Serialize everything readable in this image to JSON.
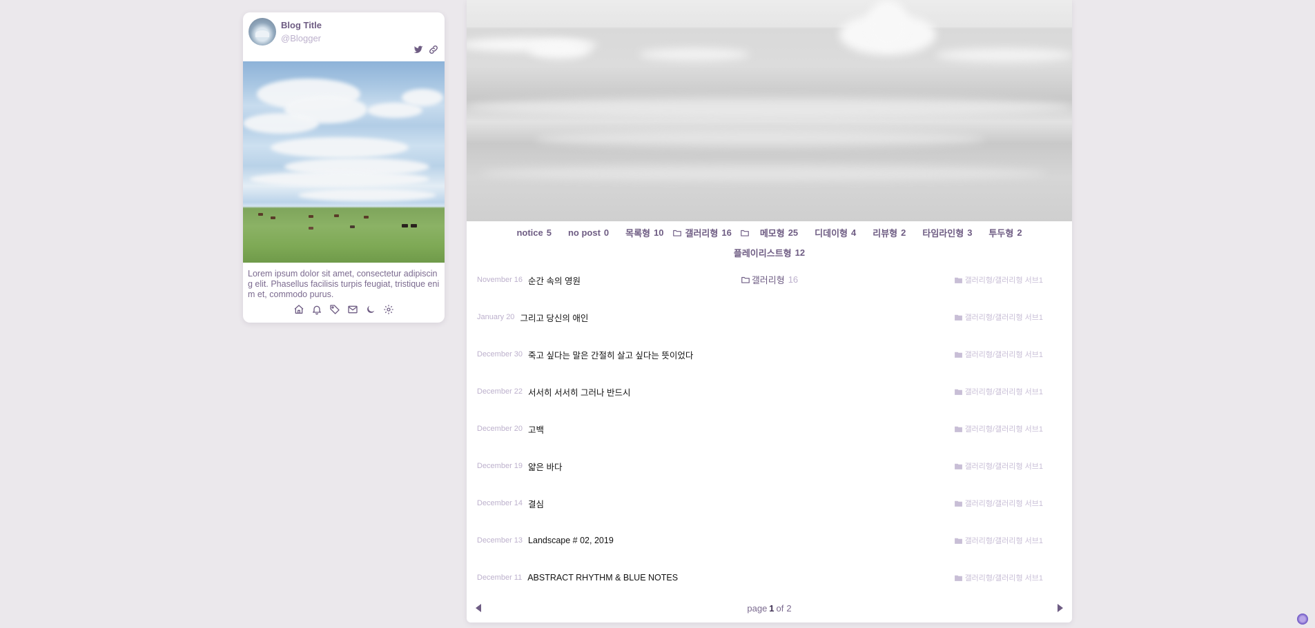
{
  "profile": {
    "title": "Blog Title",
    "username": "@Blogger",
    "description": "Lorem ipsum dolor sit amet, consectetur adipiscing elit. Phasellus facilisis turpis feugiat, tristique enim et, commodo purus.",
    "social_icons": [
      "twitter-icon",
      "link-icon"
    ],
    "bottom_icons": [
      "home-icon",
      "bell-icon",
      "tag-icon",
      "mail-icon",
      "moon-icon",
      "gear-icon"
    ]
  },
  "nav": {
    "items": [
      {
        "label": "notice",
        "count": "5",
        "folder": false
      },
      {
        "label": "no post",
        "count": "0",
        "folder": false
      },
      {
        "label": "목록형",
        "count": "10",
        "folder": false
      },
      {
        "label": "갤러리형",
        "count": "16",
        "folder": true
      },
      {
        "label": "메모형",
        "count": "25",
        "folder": true
      },
      {
        "label": "디데이형",
        "count": "4",
        "folder": false
      },
      {
        "label": "리뷰형",
        "count": "2",
        "folder": false
      },
      {
        "label": "타임라인형",
        "count": "3",
        "folder": false
      },
      {
        "label": "투두형",
        "count": "2",
        "folder": false
      },
      {
        "label": "플레이리스트형",
        "count": "12",
        "folder": false
      }
    ],
    "current": {
      "label": "갤러리형",
      "count": "16"
    }
  },
  "posts": [
    {
      "date": "November 16",
      "title": "순간 속의 영원",
      "category": "갤러리형/갤러리형 서브1"
    },
    {
      "date": "January 20",
      "title": "그리고 당신의 애인",
      "category": "갤러리형/갤러리형 서브1"
    },
    {
      "date": "December 30",
      "title": "죽고 싶다는 말은 간절히 살고 싶다는 뜻이었다",
      "category": "갤러리형/갤러리형 서브1"
    },
    {
      "date": "December 22",
      "title": "서서히 서서히 그러나 반드시",
      "category": "갤러리형/갤러리형 서브1"
    },
    {
      "date": "December 20",
      "title": "고백",
      "category": "갤러리형/갤러리형 서브1"
    },
    {
      "date": "December 19",
      "title": "얇은 바다",
      "category": "갤러리형/갤러리형 서브1"
    },
    {
      "date": "December 14",
      "title": "결심",
      "category": "갤러리형/갤러리형 서브1"
    },
    {
      "date": "December 13",
      "title": "Landscape # 02, 2019",
      "category": "갤러리형/갤러리형 서브1"
    },
    {
      "date": "December 11",
      "title": "ABSTRACT RHYTHM & BLUE NOTES",
      "category": "갤러리형/갤러리형 서브1"
    }
  ],
  "pager": {
    "prefix": "page",
    "current": "1",
    "sep": "of",
    "total": "2"
  },
  "colors": {
    "accent": "#6e5c83",
    "muted": "#bcb0cc",
    "background": "#ebe8ec"
  }
}
